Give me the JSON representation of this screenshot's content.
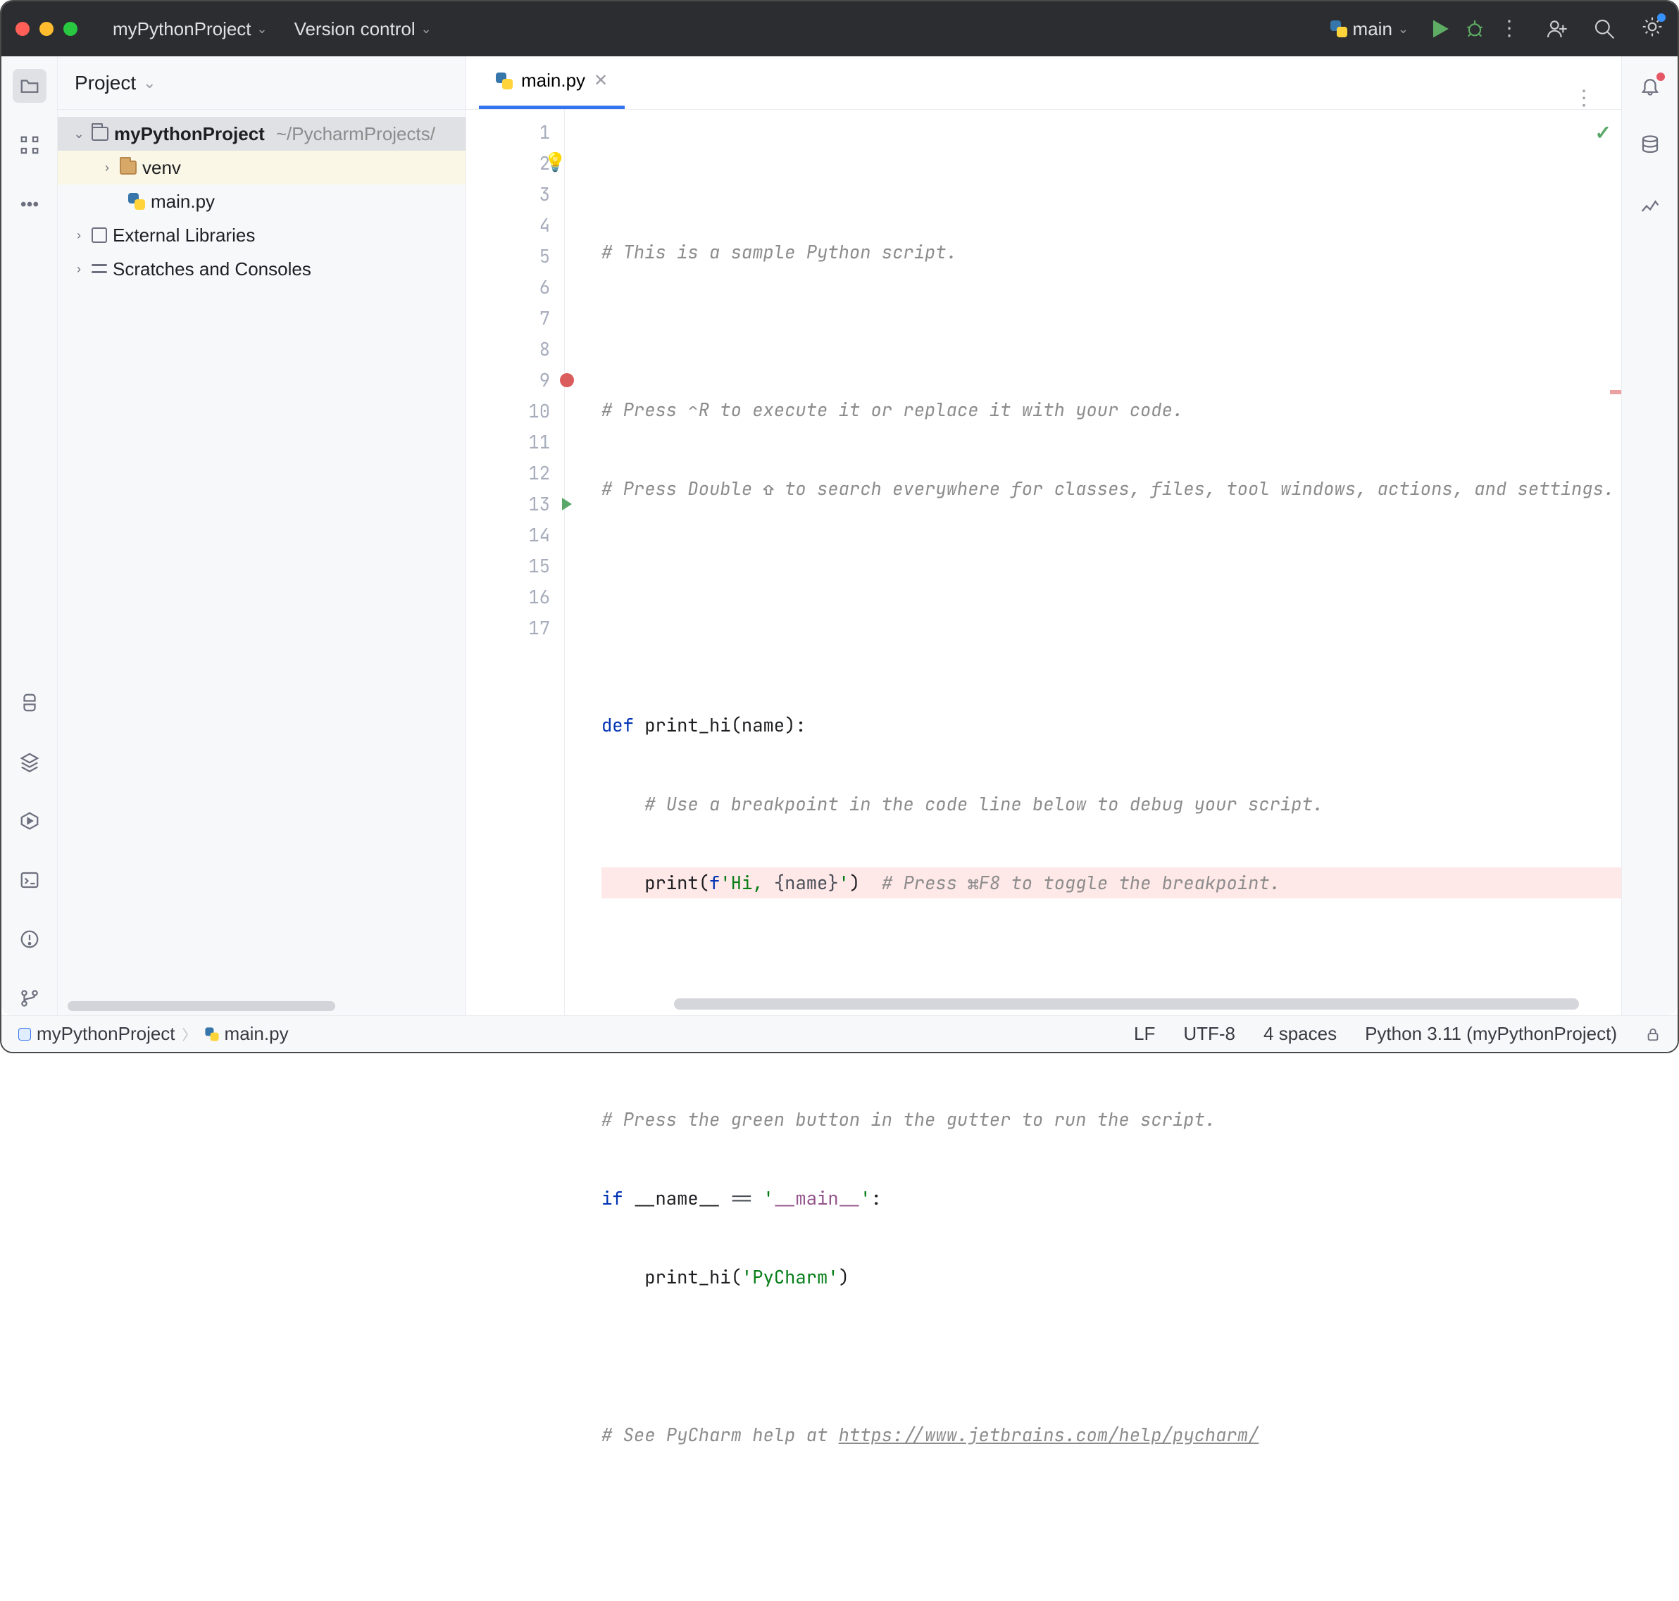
{
  "titlebar": {
    "project": "myPythonProject",
    "vcs": "Version control",
    "run_config": "main"
  },
  "rail_left": [
    "project",
    "structure",
    "more",
    "python-console",
    "packages",
    "services",
    "terminal",
    "problems",
    "vcs"
  ],
  "rail_right": [
    "notifications",
    "database",
    "ai"
  ],
  "project_panel": {
    "title": "Project",
    "root": {
      "name": "myPythonProject",
      "path": "~/PycharmProjects/"
    },
    "venv": "venv",
    "main_file": "main.py",
    "external_libs": "External Libraries",
    "scratches": "Scratches and Consoles"
  },
  "tabs": {
    "main": "main.py"
  },
  "code": {
    "lines": [
      "1",
      "2",
      "3",
      "4",
      "5",
      "6",
      "7",
      "8",
      "9",
      "10",
      "11",
      "12",
      "13",
      "14",
      "15",
      "16",
      "17"
    ],
    "l1": "# This is a sample Python script.",
    "l3": "# Press ⌃R to execute it or replace it with your code.",
    "l4": "# Press Double ⇧ to search everywhere for classes, files, tool windows, actions, and settings.",
    "l7_def": "def ",
    "l7_fn": "print_hi",
    "l7_params": "(name):",
    "l8": "    # Use a breakpoint in the code line below to debug your script.",
    "l9_indent": "    ",
    "l9_print": "print",
    "l9_open": "(",
    "l9_f": "f",
    "l9_q1": "'",
    "l9_hi": "Hi, ",
    "l9_br": "{name}",
    "l9_q2": "'",
    "l9_close": ")",
    "l9_c": "  # Press ⌘F8 to toggle the breakpoint.",
    "l12": "# Press the green button in the gutter to run the script.",
    "l13_if": "if ",
    "l13_name": "__name__",
    "l13_eq": " == ",
    "l13_q": "'",
    "l13_main": "__main__",
    "l13_q2": "'",
    "l13_colon": ":",
    "l14_indent": "    ",
    "l14_fn": "print_hi",
    "l14_open": "(",
    "l14_arg": "'PyCharm'",
    "l14_close": ")",
    "l16_pre": "# See PyCharm help at ",
    "l16_url": "https://www.jetbrains.com/help/pycharm/"
  },
  "status": {
    "crumb_root": "myPythonProject",
    "crumb_file": "main.py",
    "line_sep": "LF",
    "encoding": "UTF-8",
    "indent": "4 spaces",
    "interpreter": "Python 3.11 (myPythonProject)"
  }
}
